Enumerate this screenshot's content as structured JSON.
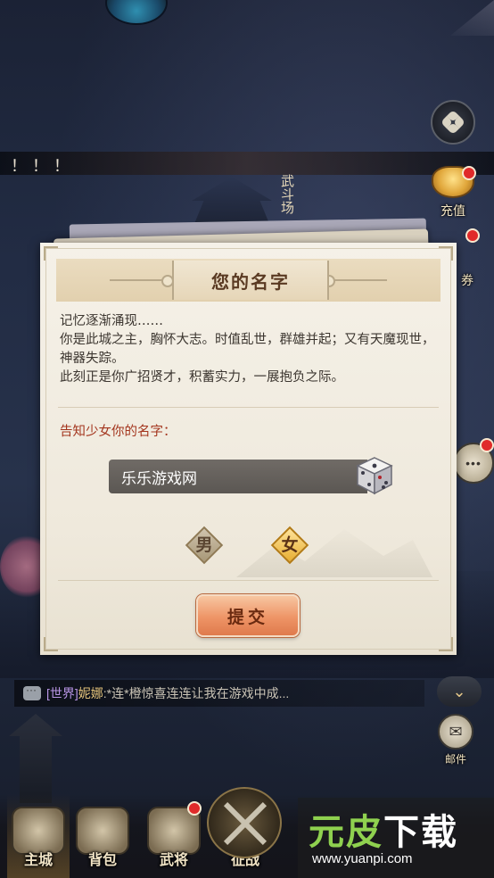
{
  "background": {
    "exclaim_text": "！！！",
    "arena_sign": "武斗场"
  },
  "side": {
    "recharge_label": "充值",
    "coupon_label": "券",
    "mail_label": "邮件"
  },
  "dialog": {
    "title": "您的名字",
    "story_lines": [
      "记忆逐渐涌现……",
      "你是此城之主，胸怀大志。时值乱世，群雄并起；又有天魔现世，神器失踪。",
      "此刻正是你广招贤才，积蓄实力，一展抱负之际。"
    ],
    "prompt": "告知少女你的名字：",
    "name_value": "乐乐游戏网",
    "gender_male": "男",
    "gender_female": "女",
    "selected_gender": "女",
    "submit_label": "提交"
  },
  "chat": {
    "channel": "[世界]",
    "user": "妮娜",
    "message": ":*连*橙惊喜连连让我在游戏中成..."
  },
  "nav": {
    "items": [
      {
        "label": "主城"
      },
      {
        "label": "背包"
      },
      {
        "label": "武将"
      },
      {
        "label": "征战"
      }
    ]
  },
  "watermark": {
    "title_green": "元皮",
    "title_white": "下载",
    "url": "www.yuanpi.com"
  },
  "colors": {
    "prompt": "#a3351d",
    "submit": "#ee9466",
    "female_selected": "#e7ae32",
    "notify_dot": "#e02a2a"
  }
}
